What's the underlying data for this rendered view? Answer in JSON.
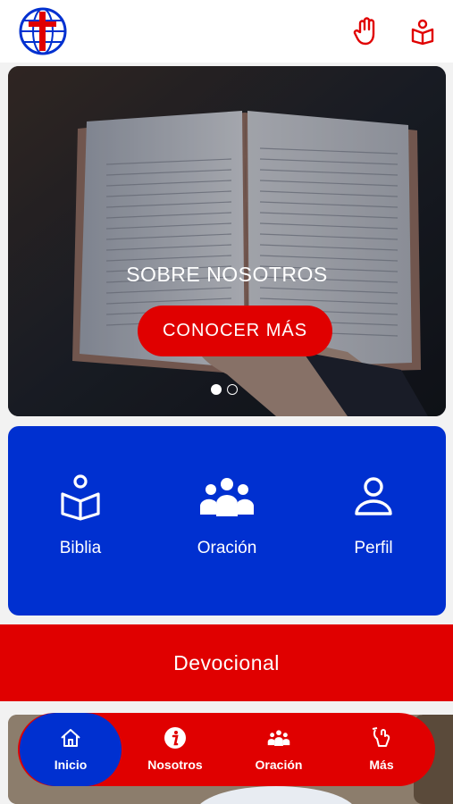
{
  "header": {
    "logo": "church-cross-globe-logo",
    "icons": [
      "prayer-hand-icon",
      "bible-reader-icon"
    ]
  },
  "hero": {
    "title": "SOBRE NOSOTROS",
    "button_label": "CONOCER MÁS",
    "slides_total": 2,
    "active_slide": 1
  },
  "quick_links": [
    {
      "label": "Biblia",
      "icon": "bible-icon"
    },
    {
      "label": "Oración",
      "icon": "group-icon"
    },
    {
      "label": "Perfil",
      "icon": "profile-icon"
    }
  ],
  "devotional": {
    "label": "Devocional"
  },
  "bottom_nav": [
    {
      "label": "Inicio",
      "icon": "home-icon",
      "active": true
    },
    {
      "label": "Nosotros",
      "icon": "info-icon"
    },
    {
      "label": "Oración",
      "icon": "group-icon"
    },
    {
      "label": "Más",
      "icon": "hand-icon"
    }
  ],
  "colors": {
    "red": "#e00000",
    "blue": "#0030d0",
    "white": "#ffffff"
  }
}
